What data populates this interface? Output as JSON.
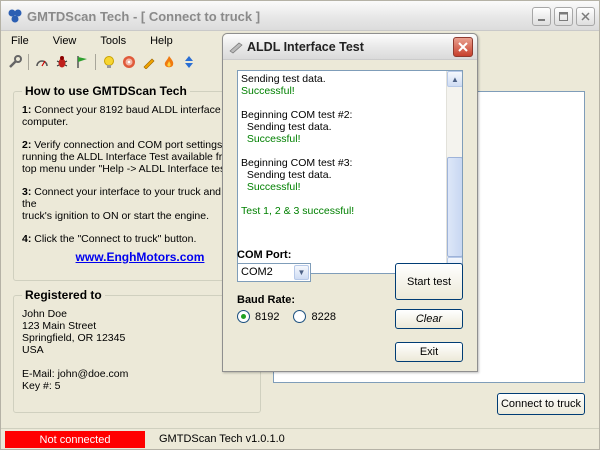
{
  "app": {
    "title": "GMTDScan Tech - [ Connect to truck ]",
    "menu": [
      "File",
      "View",
      "Tools",
      "Help"
    ],
    "toolbar_icons": [
      "wrench-icon",
      "gauge-icon",
      "bug-icon",
      "flag-icon",
      "lightbulb-icon",
      "cd-icon",
      "pencil-icon",
      "fire-icon",
      "arrows-icon"
    ]
  },
  "howto": {
    "title": "How to use GMTDScan Tech",
    "steps": [
      {
        "num": "1:",
        "text": " Connect your 8192 baud ALDL interface to your\ncomputer."
      },
      {
        "num": "2:",
        "text": " Verify connection and COM port settings by\nrunning the ALDL Interface Test available from the\ntop menu under \"Help -> ALDL Interface test\"."
      },
      {
        "num": "3:",
        "text": " Connect your interface to your truck and turn the\ntruck's ignition to ON or start the engine."
      },
      {
        "num": "4:",
        "text": " Click the \"Connect to truck\" button."
      }
    ],
    "link": "www.EnghMotors.com"
  },
  "registered": {
    "title": "Registered to",
    "lines": [
      "John Doe",
      "123 Main Street",
      "Springfield, OR 12345",
      "USA",
      "",
      "E-Mail: john@doe.com",
      "Key #: 5"
    ]
  },
  "connect_button": "Connect to truck",
  "status": {
    "connection": "Not connected",
    "version": "GMTDScan Tech v1.0.1.0",
    "connection_color": "#ff0000"
  },
  "dialog": {
    "title": "ALDL Interface Test",
    "log": [
      {
        "text": "Sending test data.",
        "ok": false
      },
      {
        "text": "Successful!",
        "ok": true
      },
      {
        "text": "",
        "ok": false
      },
      {
        "text": "Beginning COM test #2:",
        "ok": false
      },
      {
        "text": "  Sending test data.",
        "ok": false
      },
      {
        "text": "  Successful!",
        "ok": true
      },
      {
        "text": "",
        "ok": false
      },
      {
        "text": "Beginning COM test #3:",
        "ok": false
      },
      {
        "text": "  Sending test data.",
        "ok": false
      },
      {
        "text": "  Successful!",
        "ok": true
      },
      {
        "text": "",
        "ok": false
      },
      {
        "text": "Test 1, 2 & 3 successful!",
        "ok": true
      }
    ],
    "com_label": "COM Port:",
    "com_value": "COM2",
    "baud_label": "Baud Rate:",
    "baud_options": [
      "8192",
      "8228"
    ],
    "baud_selected": "8192",
    "start_label": "Start test",
    "clear_label": "Clear",
    "exit_label": "Exit",
    "success_color": "#008000"
  }
}
